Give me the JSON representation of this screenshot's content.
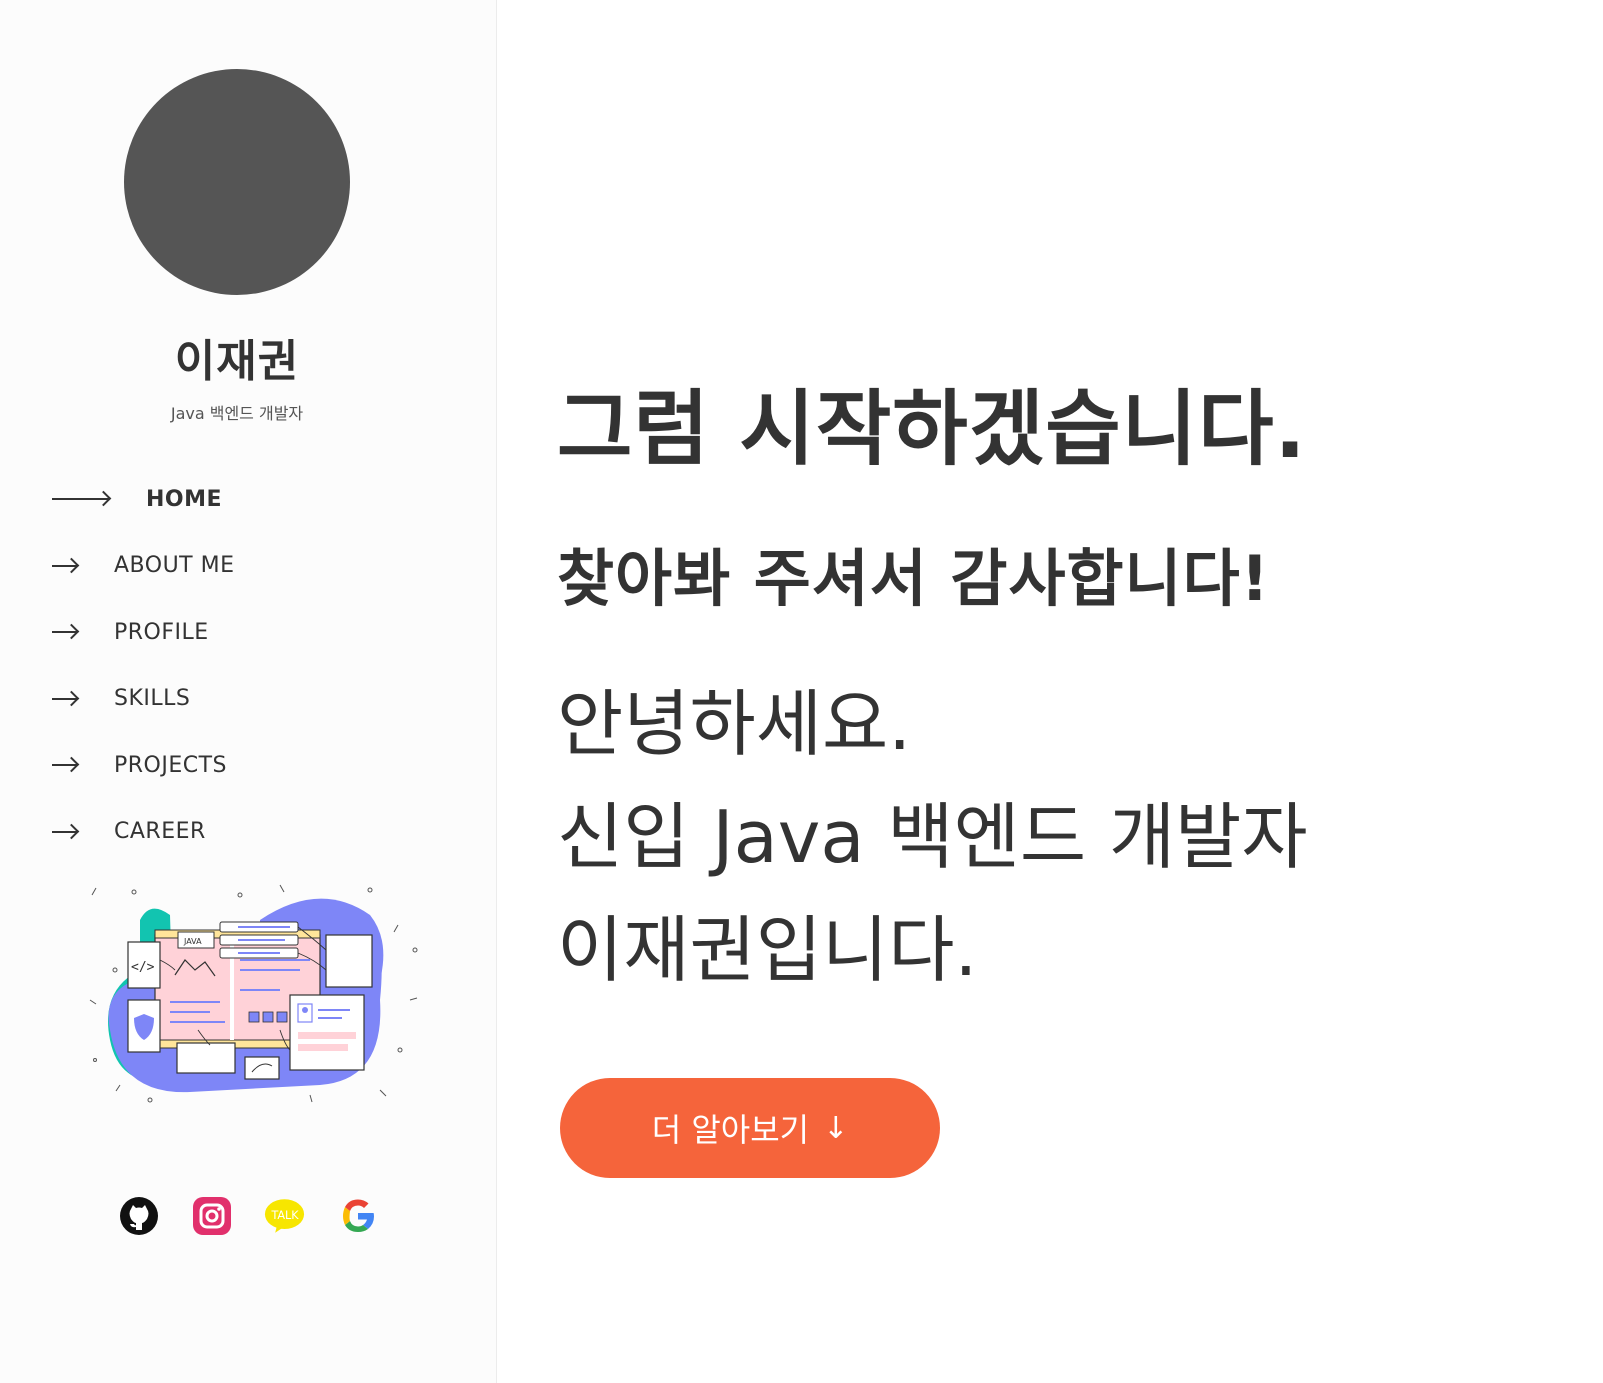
{
  "profile": {
    "name": "이재권",
    "role": "Java 백엔드 개발자"
  },
  "nav": {
    "items": [
      {
        "label": "HOME",
        "active": true
      },
      {
        "label": "ABOUT ME",
        "active": false
      },
      {
        "label": "PROFILE",
        "active": false
      },
      {
        "label": "SKILLS",
        "active": false
      },
      {
        "label": "PROJECTS",
        "active": false
      },
      {
        "label": "CAREER",
        "active": false
      }
    ]
  },
  "illustration": {
    "label": "JAVA",
    "code_tag": "</>"
  },
  "socials": [
    {
      "icon": "github-icon",
      "color": "#111111"
    },
    {
      "icon": "instagram-icon",
      "color": "#e1306c"
    },
    {
      "icon": "kakaotalk-icon",
      "color": "#f7e600",
      "text": "TALK"
    },
    {
      "icon": "google-icon",
      "color": "#4285f4"
    }
  ],
  "hero": {
    "headline": "그럼 시작하겠습니다.",
    "subheadline": "찾아봐 주셔서 감사합니다!",
    "intro_lines": [
      "안녕하세요.",
      "신입 Java 백엔드 개발자",
      "이재권입니다."
    ],
    "cta_label": "더 알아보기",
    "cta_arrow": "↓"
  },
  "colors": {
    "accent": "#f5643b",
    "avatar": "#555555",
    "text": "#333333"
  }
}
